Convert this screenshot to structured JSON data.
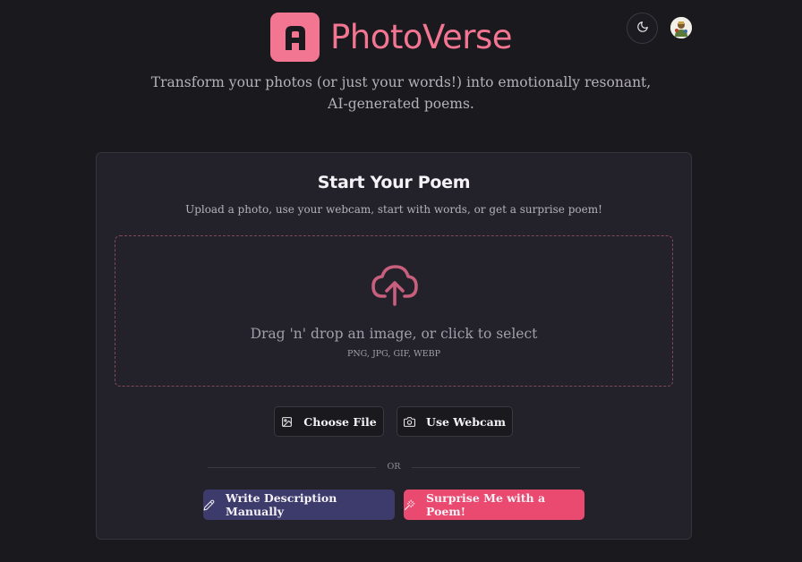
{
  "header": {
    "brand_name": "PhotoVerse",
    "logo_icon": "camera-app-logo",
    "theme_toggle_icon": "moon-icon",
    "avatar_icon": "user-avatar",
    "tagline": "Transform your photos (or just your words!) into emotionally resonant, AI-generated poems."
  },
  "card": {
    "title": "Start Your Poem",
    "subtitle": "Upload a photo, use your webcam, start with words, or get a surprise poem!",
    "dropzone": {
      "icon": "cloud-upload-icon",
      "text": "Drag 'n' drop an image, or click to select",
      "formats": "PNG, JPG, GIF, WEBP"
    },
    "buttons": {
      "choose_file": "Choose File",
      "use_webcam": "Use Webcam",
      "write_manually": "Write Description Manually",
      "surprise": "Surprise Me with a Poem!"
    },
    "or_label": "OR"
  },
  "colors": {
    "accent": "#f27592",
    "background": "#1a191e",
    "card": "#23222a",
    "indigo_button": "#3d3b6c",
    "pink_button": "#ea4a70"
  }
}
